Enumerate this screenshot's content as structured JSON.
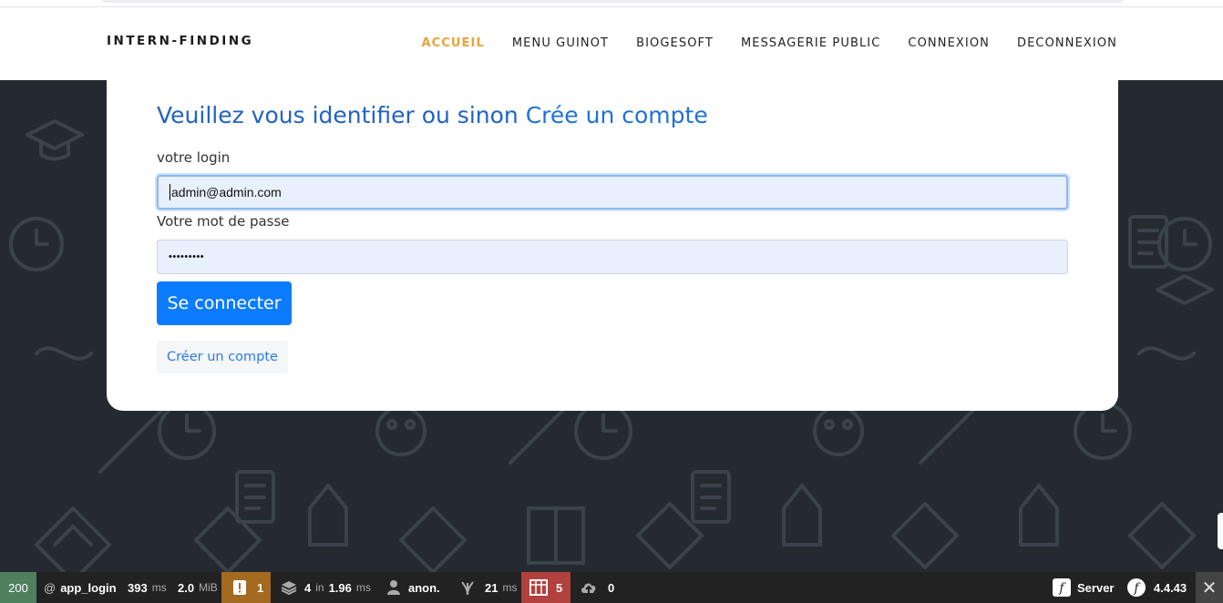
{
  "navbar": {
    "brand": "INTERN-FINDING",
    "items": [
      {
        "label": "ACCUEIL",
        "active": true
      },
      {
        "label": "MENU GUINOT",
        "active": false
      },
      {
        "label": "BIOGESOFT",
        "active": false
      },
      {
        "label": "MESSAGERIE PUBLIC",
        "active": false
      },
      {
        "label": "CONNEXION",
        "active": false
      },
      {
        "label": "DECONNEXION",
        "active": false
      }
    ]
  },
  "login": {
    "title_prefix": "Veuillez vous identifier ou sinon",
    "title_link": "Crée un compte",
    "login_label": "votre login",
    "login_value": "admin@admin.com",
    "password_label": "Votre mot de passe",
    "password_value": "•••••••••",
    "submit_label": "Se connecter",
    "create_account_label": "Créer un compte"
  },
  "toolbar": {
    "status_code": "200",
    "route_prefix": "@",
    "route": "app_login",
    "time_value": "393",
    "time_unit": "ms",
    "memory_value": "2.0",
    "memory_unit": "MiB",
    "warnings_count": "1",
    "twig_count": "4",
    "twig_in": "in",
    "twig_time": "1.96",
    "twig_unit": "ms",
    "user": "anon.",
    "db_time": "21",
    "db_unit": "ms",
    "errors_count": "5",
    "ajax_count": "0",
    "server_label": "Server",
    "sf_version": "4.4.43",
    "close_glyph": "✕"
  },
  "colors": {
    "accent_active": "#e8a33c",
    "primary": "#0b7bff",
    "title": "#2063c4",
    "status_ok": "#4f805d",
    "warning": "#a46a1f",
    "error": "#b0413e"
  }
}
